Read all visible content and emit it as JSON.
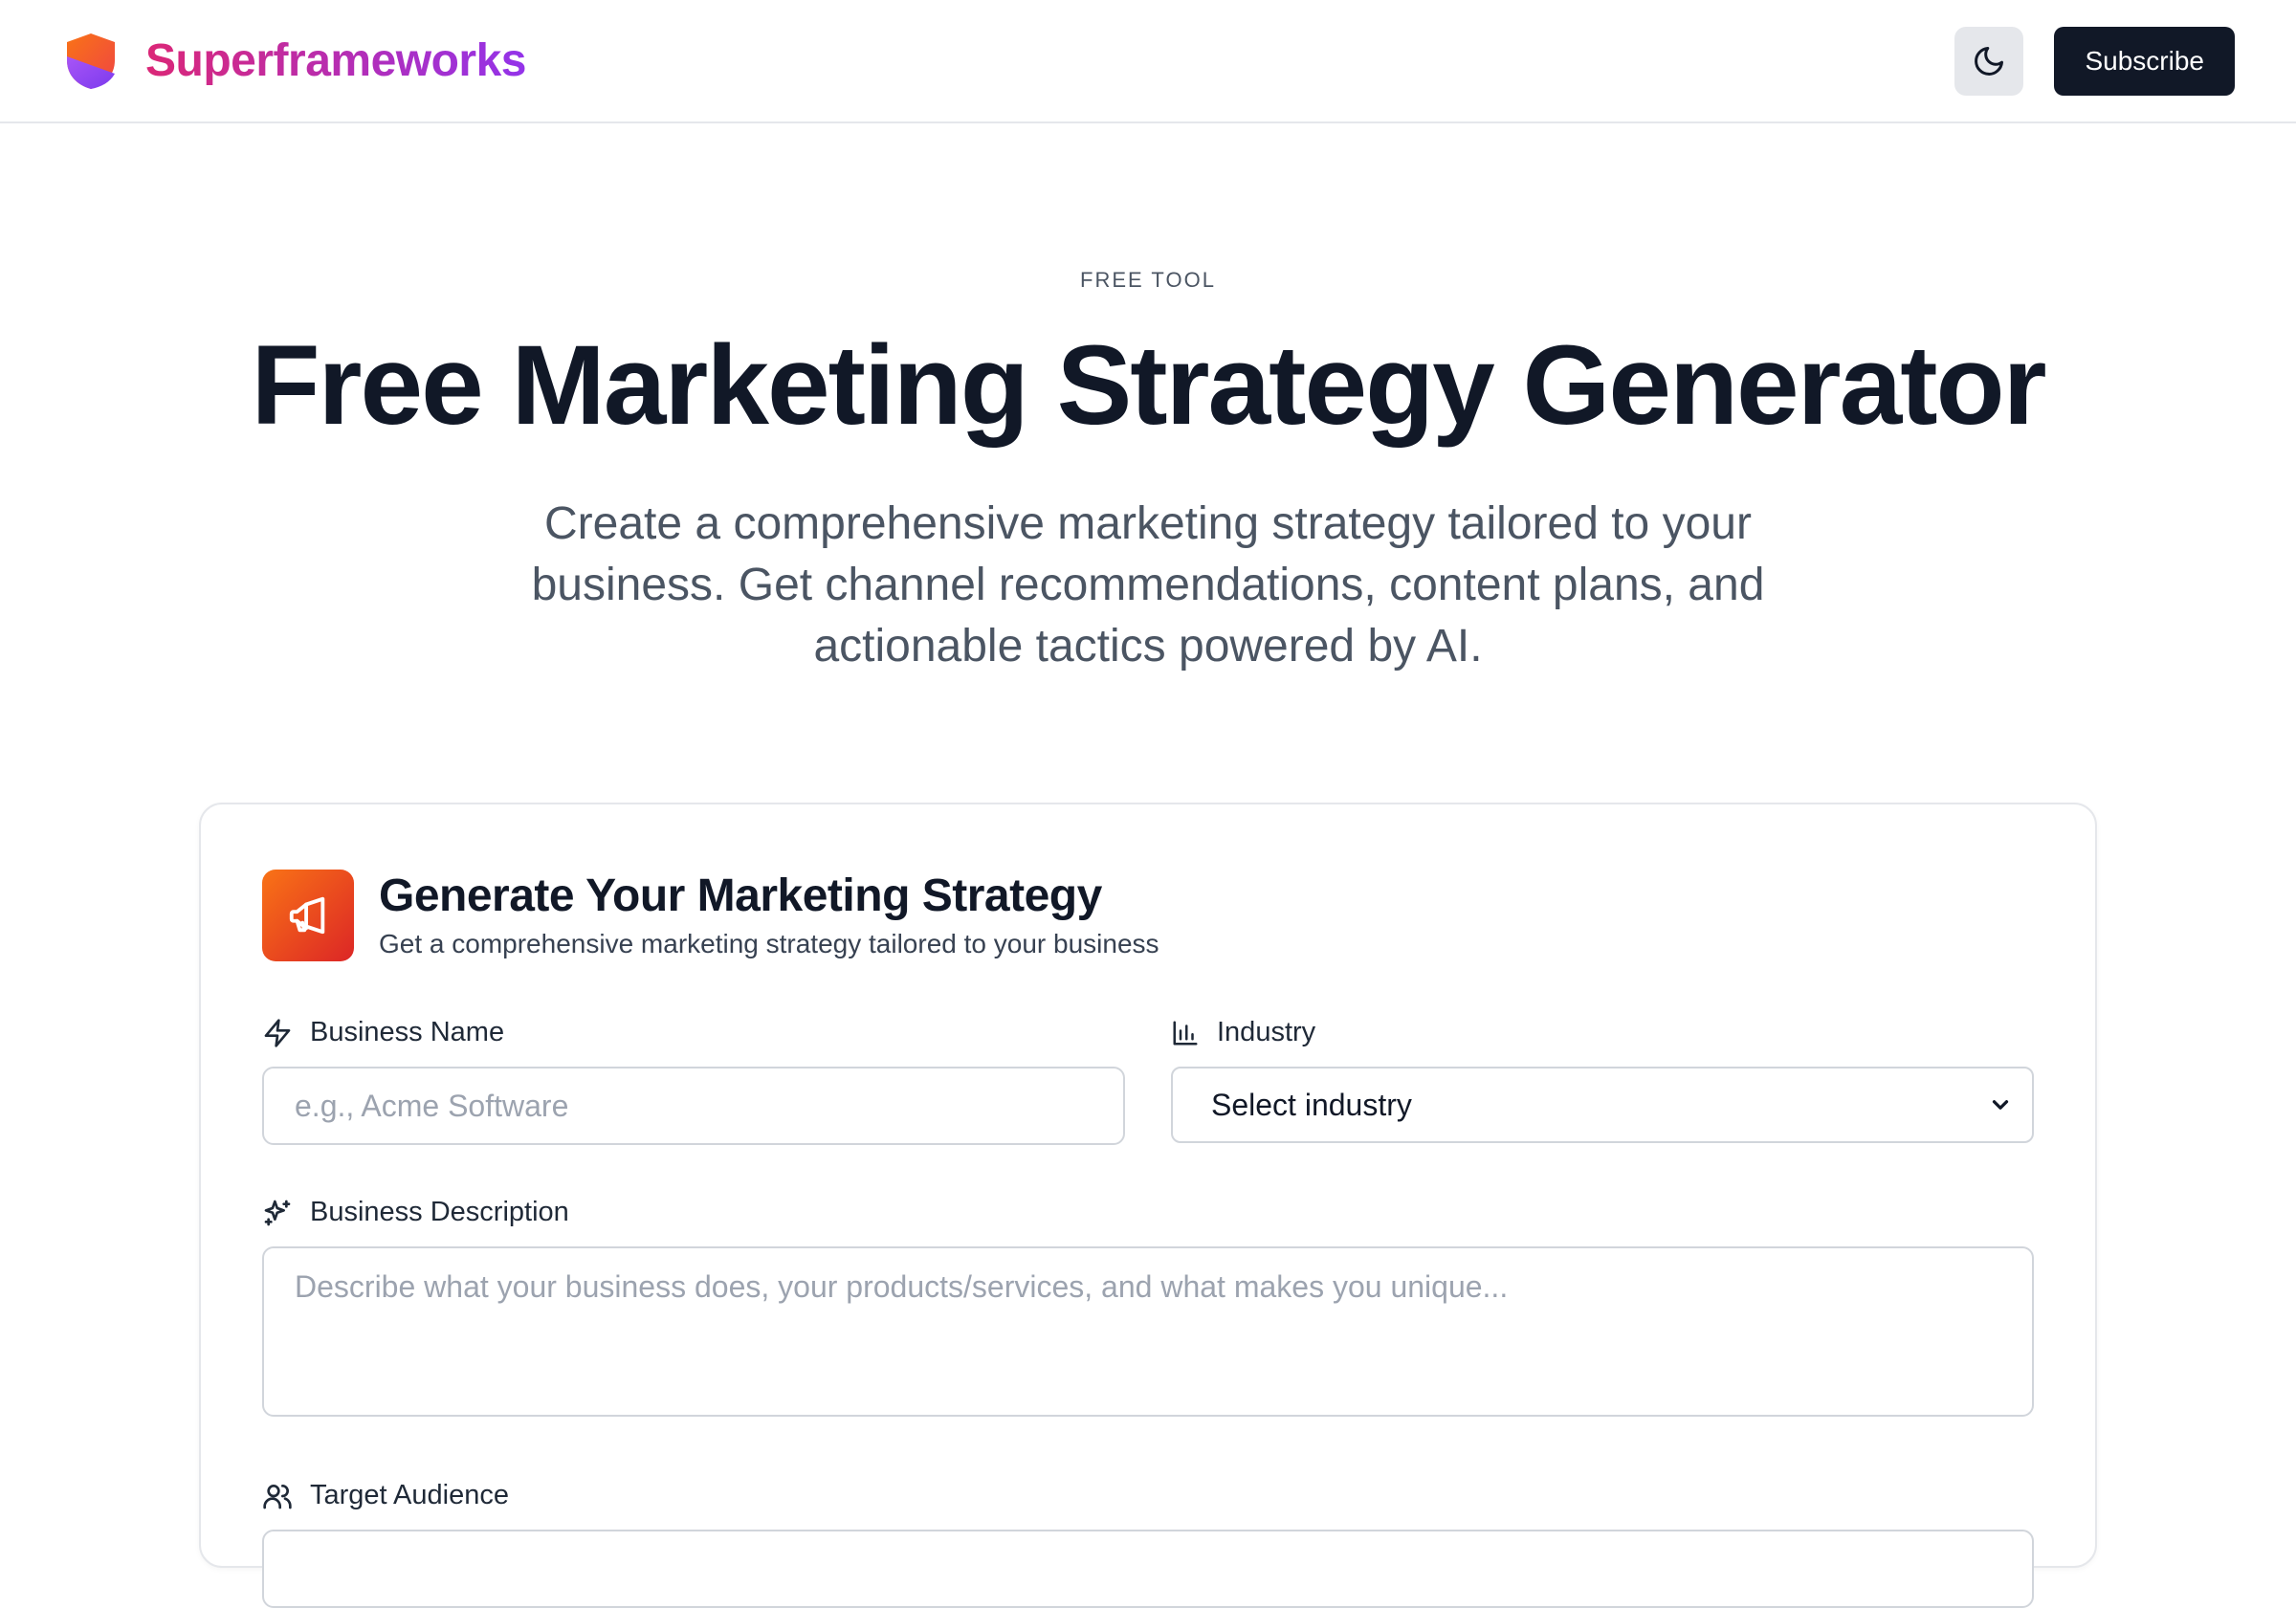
{
  "header": {
    "brand_name": "Superframeworks",
    "theme_toggle_icon": "moon-icon",
    "subscribe_label": "Subscribe"
  },
  "hero": {
    "eyebrow": "FREE TOOL",
    "title": "Free Marketing Strategy Generator",
    "subtitle": "Create a comprehensive marketing strategy tailored to your business. Get channel recommendations, content plans, and actionable tactics powered by AI."
  },
  "form": {
    "icon": "megaphone-icon",
    "title": "Generate Your Marketing Strategy",
    "subtitle": "Get a comprehensive marketing strategy tailored to your business",
    "business_name": {
      "label": "Business Name",
      "icon": "lightning-icon",
      "placeholder": "e.g., Acme Software",
      "value": ""
    },
    "industry": {
      "label": "Industry",
      "icon": "bar-chart-icon",
      "selected": "Select industry"
    },
    "business_description": {
      "label": "Business Description",
      "icon": "sparkles-icon",
      "placeholder": "Describe what your business does, your products/services, and what makes you unique...",
      "value": ""
    },
    "target_audience": {
      "label": "Target Audience",
      "icon": "users-icon"
    }
  },
  "colors": {
    "brand_gradient_start": "#db2777",
    "brand_gradient_end": "#9333ea",
    "primary_button": "#111827",
    "card_icon_start": "#f97316",
    "card_icon_end": "#dc2626"
  }
}
